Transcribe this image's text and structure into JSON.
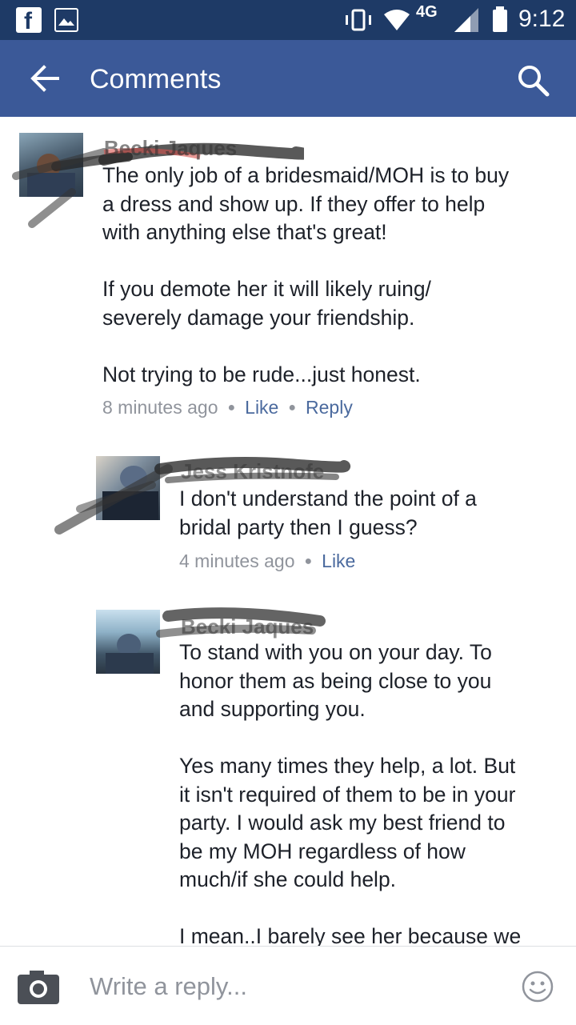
{
  "status_bar": {
    "time": "9:12",
    "network": "4G"
  },
  "header": {
    "title": "Comments"
  },
  "comments": [
    {
      "author": "Becki Jaques",
      "body": [
        "The only job of a bridesmaid/MOH is to buy",
        "a dress and show up. If they offer to help",
        "with anything else that's great!",
        "",
        "If you demote her it will likely ruing/",
        "severely damage your friendship.",
        "",
        "Not trying to be rude...just honest."
      ],
      "time": "8 minutes ago",
      "like_label": "Like",
      "reply_label": "Reply"
    },
    {
      "author": "Jess Kristnofe",
      "body": [
        "I don't understand the point of a",
        "bridal party then I guess?"
      ],
      "time": "4 minutes ago",
      "like_label": "Like"
    },
    {
      "author": "Becki Jaques",
      "body": [
        "To stand with you on your day. To",
        "honor them as being close to you",
        "and supporting you.",
        "",
        "Yes many times they help, a lot. But",
        "it isn't required of them to be in your",
        "party. I would ask my best friend to",
        "be my MOH regardless of how",
        "much/if she could help.",
        "",
        "I mean..I barely see her because we"
      ]
    }
  ],
  "composer": {
    "placeholder": "Write a reply..."
  }
}
